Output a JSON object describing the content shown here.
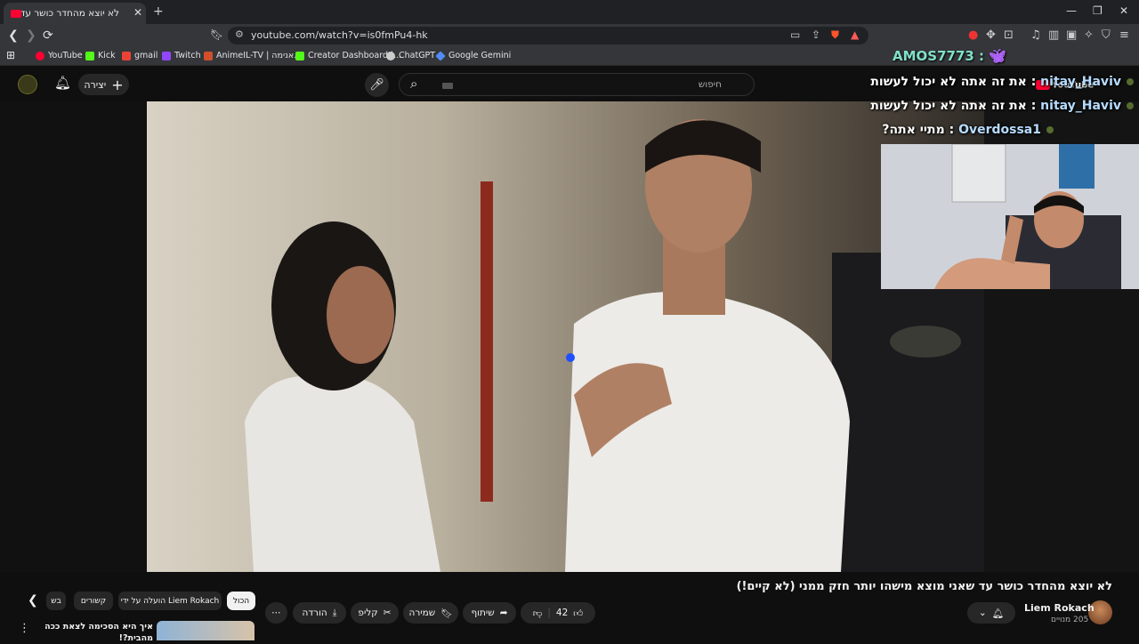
{
  "browser": {
    "tab_title": "לא יוצא מהחדר כושר עד שאני מו",
    "tab_close": "✕",
    "new_tab": "+",
    "url": "youtube.com/watch?v=is0fmPu4-hk",
    "bookmarks": [
      {
        "label": "YouTube",
        "color": "#ff0033"
      },
      {
        "label": "Kick",
        "color": "#53fc18"
      },
      {
        "label": "gmail",
        "color": "#ea4335"
      },
      {
        "label": "Twitch",
        "color": "#9146ff"
      },
      {
        "label": "AnimeIL-TV | אנימה...",
        "color": "#d14f2a"
      },
      {
        "label": "Creator Dashboard |...",
        "color": "#53fc18"
      },
      {
        "label": "ChatGPT",
        "color": "#cccccc"
      },
      {
        "label": "Google Gemini",
        "color": "#4f8df5"
      }
    ]
  },
  "youtube": {
    "create_label": "יצירה",
    "search_placeholder": "חיפוש"
  },
  "stream_overlay": {
    "top_user": "AMOS7773 :",
    "yt_badge": "YouTube",
    "chat": [
      {
        "user": "nitay_Haviv",
        "msg": ": את זה אתה לא יכול לעשות"
      },
      {
        "user": "nitay_Haviv",
        "msg": ": את זה אתה לא יכול לעשות"
      },
      {
        "user": "Overdossa1",
        "msg": ": מתיי אתה?"
      }
    ]
  },
  "video": {
    "title": "לא יוצא מהחדר כושר עד שאני מוצא מישהו יותר חזק ממני (לא קיים!)",
    "channel": "Liem Rokach",
    "subscribers": "205 מנויים",
    "like_count": "42",
    "share_label": "שיתוף",
    "save_label": "שמירה",
    "clip_label": "קליפ",
    "download_label": "הורדה"
  },
  "chips": [
    {
      "label": "הכול",
      "active": true
    },
    {
      "label": "הועלה על ידי Liem Rokach",
      "active": false
    },
    {
      "label": "קשורים",
      "active": false
    },
    {
      "label": "בש",
      "active": false
    }
  ],
  "recommendation": {
    "title": "איך היא הסכימה לצאת ככה מהבית?!"
  },
  "colors": {
    "page_bg": "#0f0f0f",
    "chrome_bg": "#35363a",
    "tabstrip_bg": "#202124",
    "yt_red": "#ff0033",
    "chat_user": "#b7dcff",
    "top_user": "#7fe0c8"
  }
}
